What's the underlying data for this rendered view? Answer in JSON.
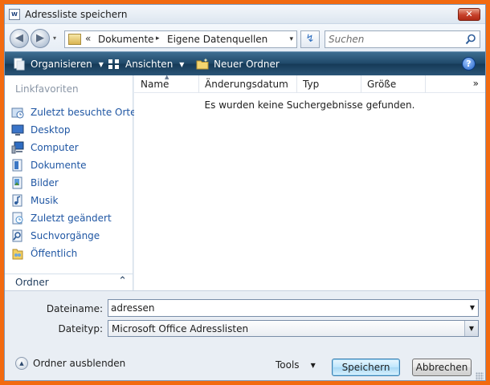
{
  "window": {
    "title": "Adressliste speichern",
    "close_glyph": "✕",
    "accent": "#f26a10"
  },
  "address_bar": {
    "overflow_glyph": "«",
    "crumbs": [
      "Dokumente",
      "Eigene Datenquellen"
    ],
    "separator_glyph": "▸",
    "dropdown_glyph": "▾",
    "search_placeholder": "Suchen",
    "icons": {
      "back": "back-arrow-icon",
      "forward": "forward-arrow-icon",
      "refresh": "refresh-icon",
      "search": "search-icon",
      "folder": "folder-icon"
    }
  },
  "toolbar": {
    "organize": "Organisieren",
    "views": "Ansichten",
    "new_folder": "Neuer Ordner",
    "help_glyph": "?",
    "caret_glyph": "▼"
  },
  "sidebar": {
    "heading": "Linkfavoriten",
    "items": [
      {
        "label": "Zuletzt besuchte Orte",
        "icon": "recent-places-icon"
      },
      {
        "label": "Desktop",
        "icon": "desktop-icon"
      },
      {
        "label": "Computer",
        "icon": "computer-icon"
      },
      {
        "label": "Dokumente",
        "icon": "documents-icon"
      },
      {
        "label": "Bilder",
        "icon": "pictures-icon"
      },
      {
        "label": "Musik",
        "icon": "music-icon"
      },
      {
        "label": "Zuletzt geändert",
        "icon": "recently-changed-icon"
      },
      {
        "label": "Suchvorgänge",
        "icon": "searches-icon"
      },
      {
        "label": "Öffentlich",
        "icon": "public-folder-icon"
      }
    ],
    "folders_label": "Ordner",
    "folders_toggle_glyph": "⌃"
  },
  "file_list": {
    "columns": [
      "Name",
      "Änderungsdatum",
      "Typ",
      "Größe"
    ],
    "more_glyph": "»",
    "empty_message": "Es wurden keine Suchergebnisse gefunden."
  },
  "form": {
    "filename_label": "Dateiname:",
    "filename_value": "adressen",
    "filetype_label": "Dateityp:",
    "filetype_value": "Microsoft Office Adresslisten",
    "dropdown_glyph": "▼"
  },
  "footer": {
    "hide_folders": "Ordner ausblenden",
    "hide_glyph": "▲",
    "tools": "Tools",
    "tools_caret": "▼",
    "save": "Speichern",
    "cancel": "Abbrechen"
  }
}
